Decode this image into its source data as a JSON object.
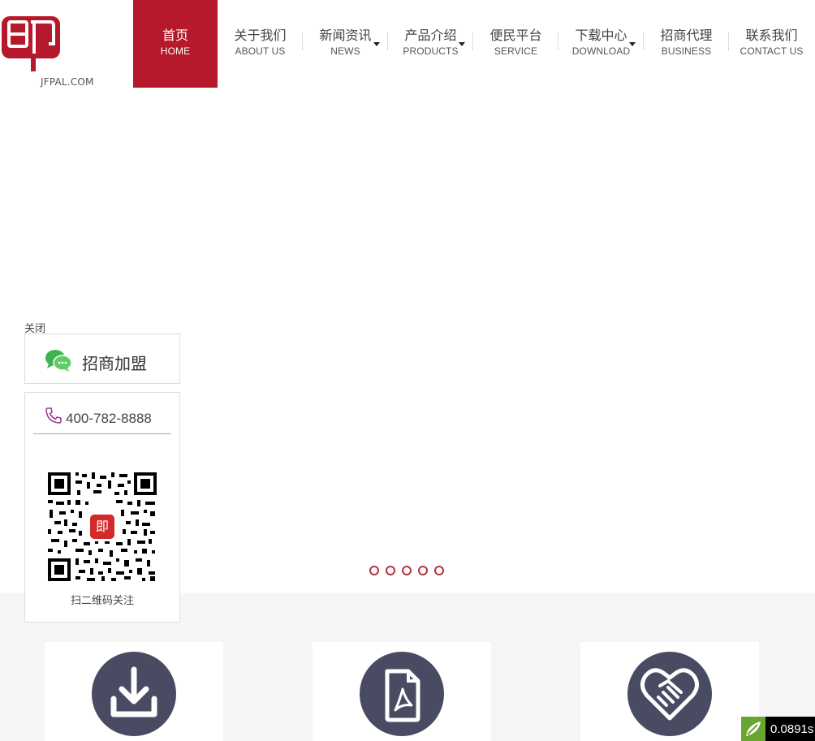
{
  "header": {
    "logo_text": "JFPAL.COM",
    "logo_glyph": "即",
    "brand_color": "#b5192b",
    "nav": [
      {
        "cn": "首页",
        "en": "HOME",
        "active": true,
        "dropdown": false
      },
      {
        "cn": "关于我们",
        "en": "ABOUT US",
        "active": false,
        "dropdown": false
      },
      {
        "cn": "新闻资讯",
        "en": "NEWS",
        "active": false,
        "dropdown": true
      },
      {
        "cn": "产品介绍",
        "en": "PRODUCTS",
        "active": false,
        "dropdown": true
      },
      {
        "cn": "便民平台",
        "en": "SERVICE",
        "active": false,
        "dropdown": false
      },
      {
        "cn": "下载中心",
        "en": "DOWNLOAD",
        "active": false,
        "dropdown": true
      },
      {
        "cn": "招商代理",
        "en": "BUSINESS",
        "active": false,
        "dropdown": false
      },
      {
        "cn": "联系我们",
        "en": "CONTACT US",
        "active": false,
        "dropdown": false
      }
    ]
  },
  "banner": {
    "slide_count": 5,
    "dot_color": "#b5323f"
  },
  "float_panel": {
    "close_label": "关闭",
    "join_label": "招商加盟",
    "join_icon": "wechat-icon",
    "phone_icon": "phone-icon",
    "phone": "400-782-8888",
    "qr_caption": "扫二维码关注"
  },
  "features": {
    "circle_color": "#484b62",
    "items": [
      {
        "icon": "download-icon"
      },
      {
        "icon": "pdf-document-icon"
      },
      {
        "icon": "handshake-heart-icon"
      }
    ]
  },
  "timer": {
    "value": "0.0891s"
  }
}
